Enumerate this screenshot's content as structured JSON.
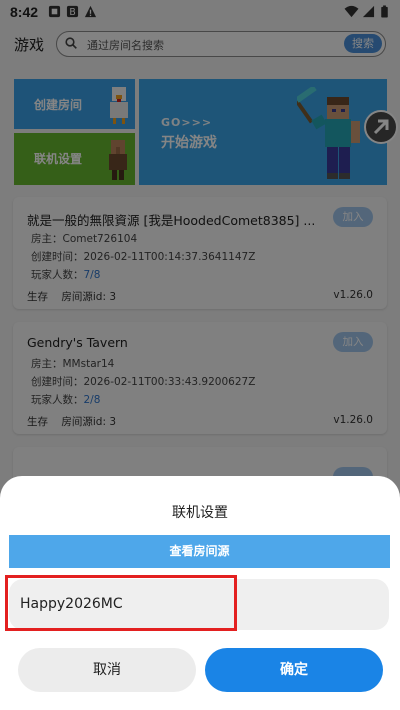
{
  "status_bar": {
    "time": "8:42"
  },
  "header": {
    "title": "游戏",
    "search_placeholder": "通过房间名搜索",
    "search_button": "搜索"
  },
  "banners": {
    "create_room": "创建房间",
    "multiplayer_settings": "联机设置",
    "start_go": "GO>>>",
    "start_game": "开始游戏"
  },
  "rooms": [
    {
      "title": "就是一般的無限資源 [我是HoodedComet8385] ...",
      "join": "加入",
      "host_label": "房主：",
      "host": "Comet726104",
      "created_label": "创建时间：",
      "created": "2026-02-11T00:14:37.3641147Z",
      "players_label": "玩家人数：",
      "players": "7/8",
      "mode": "生存",
      "source_label": "房间源id: 3",
      "version": "v1.26.0"
    },
    {
      "title": "Gendry's Tavern",
      "join": "加入",
      "host_label": "房主：",
      "host": "MMstar14",
      "created_label": "创建时间：",
      "created": "2026-02-11T00:33:43.9200627Z",
      "players_label": "玩家人数：",
      "players": "2/8",
      "mode": "生存",
      "source_label": "房间源id: 3",
      "version": "v1.26.0"
    }
  ],
  "dialog": {
    "title": "联机设置",
    "view_source": "查看房间源",
    "input_value": "Happy2026MC",
    "cancel": "取消",
    "confirm": "确定"
  },
  "colors": {
    "accent": "#1a84e6",
    "highlight_border": "#e32020",
    "player_count": "#2f74c9"
  }
}
